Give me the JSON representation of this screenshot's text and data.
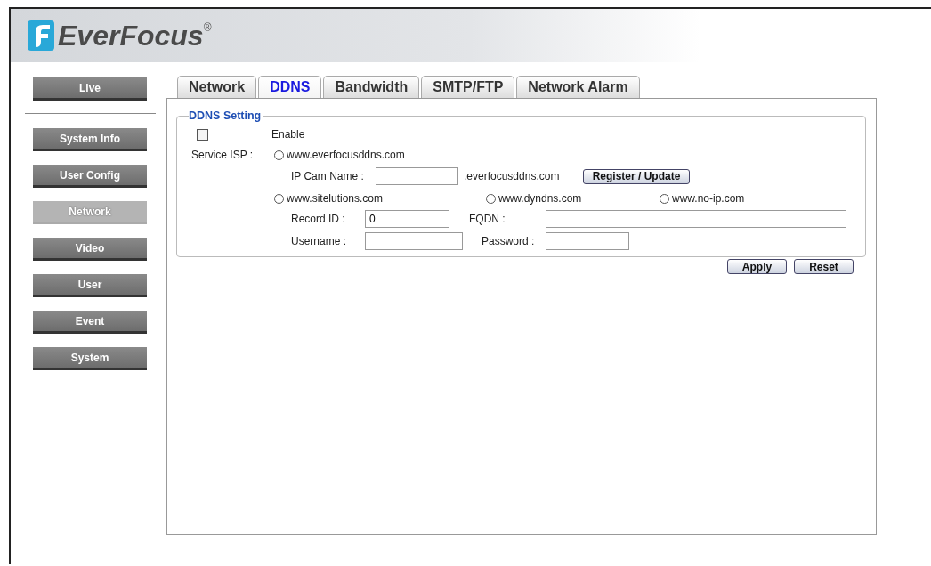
{
  "header": {
    "brand": "EverFocus",
    "registered_mark": "®"
  },
  "sidebar": {
    "items": [
      {
        "label": "Live",
        "selected": false
      },
      {
        "label": "System Info",
        "selected": false
      },
      {
        "label": "User Config",
        "selected": false
      },
      {
        "label": "Network",
        "selected": true
      },
      {
        "label": "Video",
        "selected": false
      },
      {
        "label": "User",
        "selected": false
      },
      {
        "label": "Event",
        "selected": false
      },
      {
        "label": "System",
        "selected": false
      }
    ]
  },
  "tabs": [
    {
      "label": "Network",
      "selected": false
    },
    {
      "label": "DDNS",
      "selected": true
    },
    {
      "label": "Bandwidth",
      "selected": false
    },
    {
      "label": "SMTP/FTP",
      "selected": false
    },
    {
      "label": "Network Alarm",
      "selected": false
    }
  ],
  "ddns": {
    "legend": "DDNS Setting",
    "enable": {
      "label": "Enable",
      "checked": false
    },
    "service_isp_label": "Service ISP :",
    "isps": [
      {
        "label": "www.everfocusddns.com",
        "selected": false
      },
      {
        "label": "www.sitelutions.com",
        "selected": false
      },
      {
        "label": "www.dyndns.com",
        "selected": false
      },
      {
        "label": "www.no-ip.com",
        "selected": false
      }
    ],
    "ip_cam_name": {
      "label": "IP Cam Name :",
      "suffix": ".everfocusddns.com"
    },
    "register_button": "Register / Update",
    "record_id": {
      "label": "Record ID :",
      "value": "0"
    },
    "fqdn": {
      "label": "FQDN :"
    },
    "username": {
      "label": "Username :"
    },
    "password": {
      "label": "Password :"
    }
  },
  "buttons": [
    "Apply",
    "Reset"
  ]
}
